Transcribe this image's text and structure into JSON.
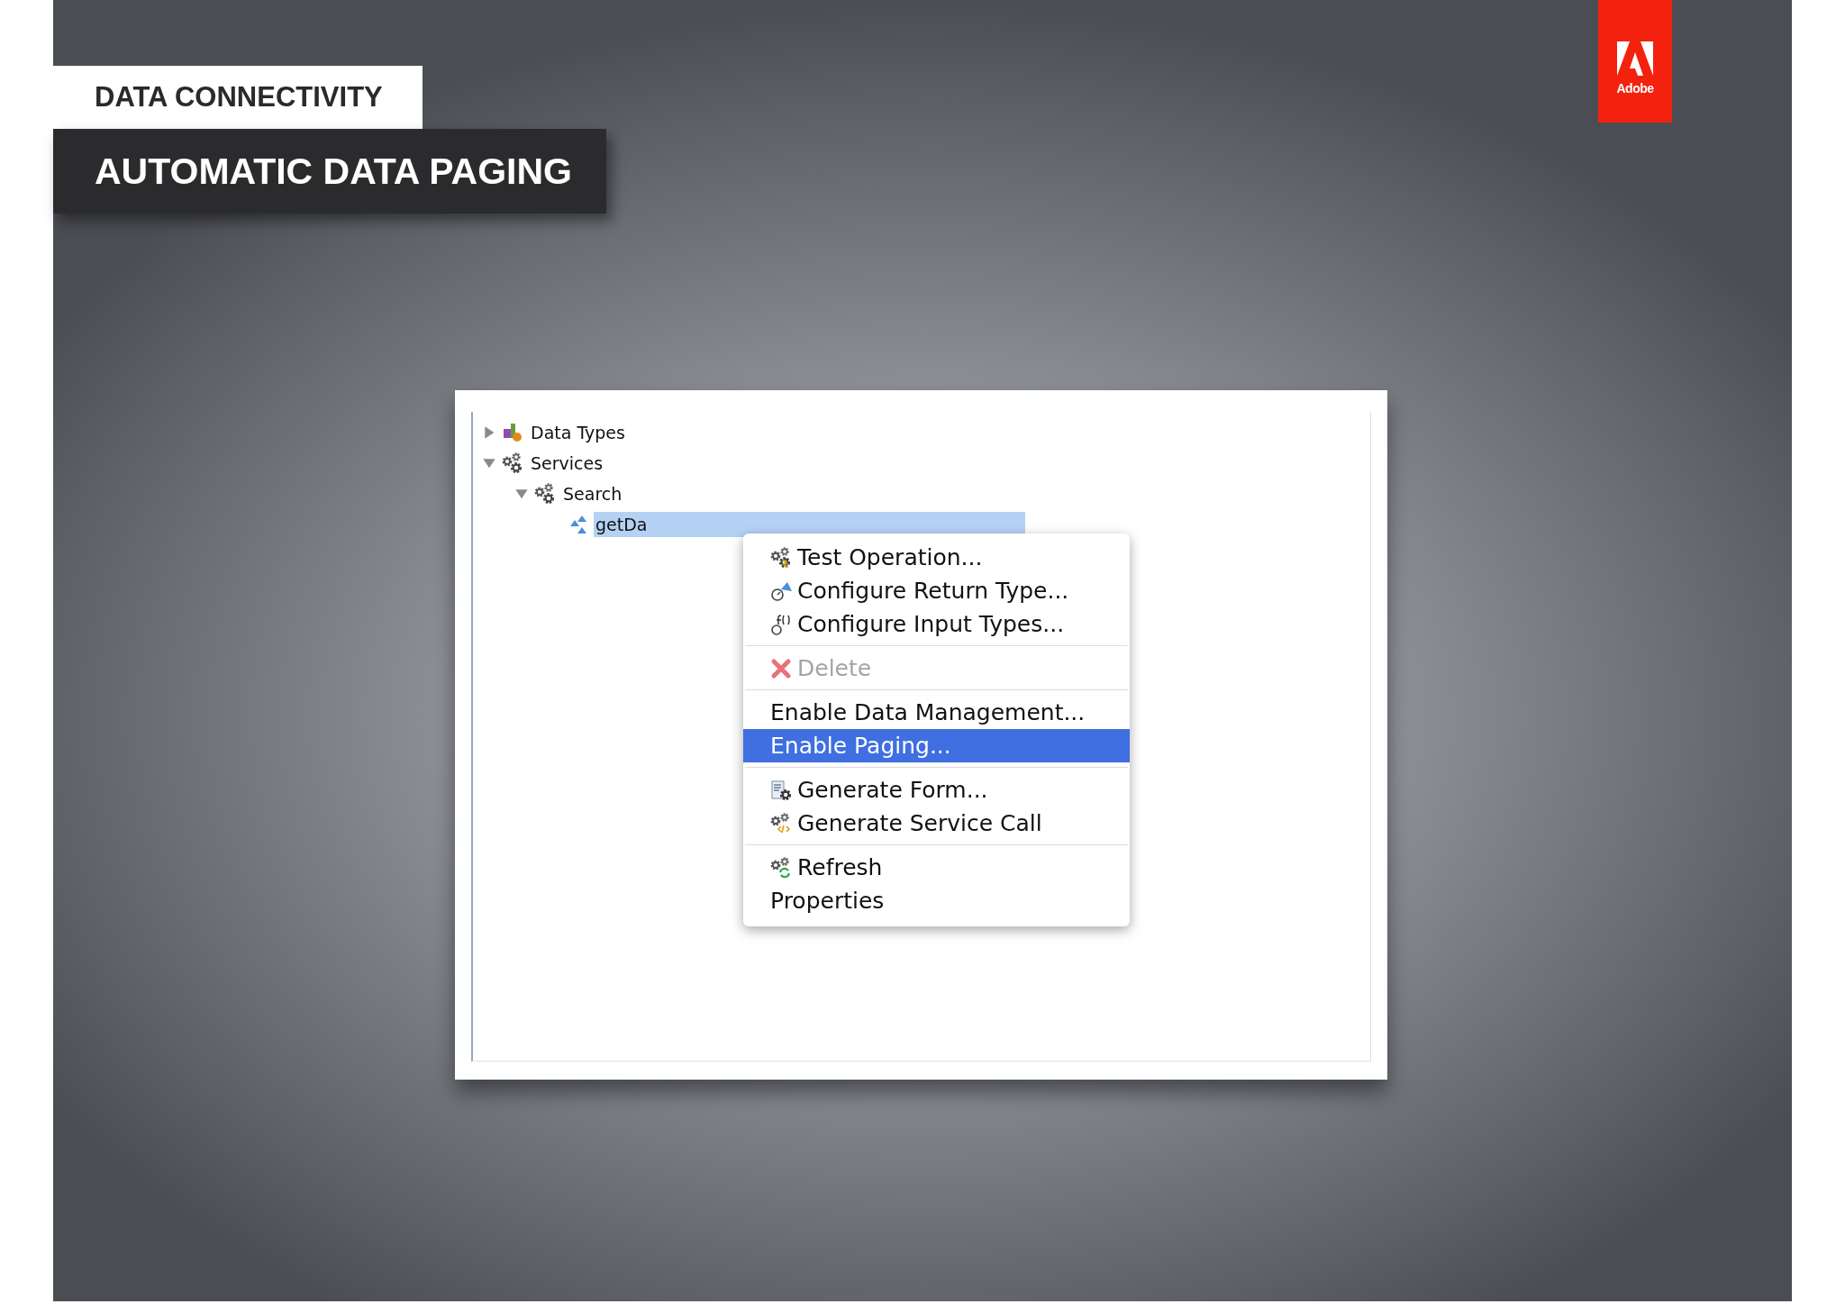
{
  "header": {
    "category": "DATA CONNECTIVITY",
    "title": "AUTOMATIC DATA PAGING"
  },
  "logo": {
    "text": "Adobe"
  },
  "tree": [
    {
      "label": "Data Types",
      "expanded": false,
      "selected": false
    },
    {
      "label": "Services",
      "expanded": true,
      "selected": false,
      "children": [
        {
          "label": "Search",
          "expanded": true,
          "selected": false,
          "children": [
            {
              "label": "getDa",
              "selected": true
            }
          ]
        }
      ]
    }
  ],
  "context_menu": [
    {
      "kind": "item",
      "label": "Test Operation...",
      "disabled": false,
      "selected": false
    },
    {
      "kind": "item",
      "label": "Configure Return Type...",
      "disabled": false,
      "selected": false
    },
    {
      "kind": "item",
      "label": "Configure Input Types...",
      "disabled": false,
      "selected": false
    },
    {
      "kind": "separator"
    },
    {
      "kind": "item",
      "label": "Delete",
      "disabled": true,
      "selected": false
    },
    {
      "kind": "separator"
    },
    {
      "kind": "item",
      "label": "Enable Data Management...",
      "disabled": false,
      "selected": false
    },
    {
      "kind": "item",
      "label": "Enable Paging...",
      "disabled": false,
      "selected": true
    },
    {
      "kind": "separator"
    },
    {
      "kind": "item",
      "label": "Generate Form...",
      "disabled": false,
      "selected": false
    },
    {
      "kind": "item",
      "label": "Generate Service Call",
      "disabled": false,
      "selected": false
    },
    {
      "kind": "separator"
    },
    {
      "kind": "item",
      "label": "Refresh",
      "disabled": false,
      "selected": false
    },
    {
      "kind": "item",
      "label": "Properties",
      "disabled": false,
      "selected": false
    }
  ]
}
